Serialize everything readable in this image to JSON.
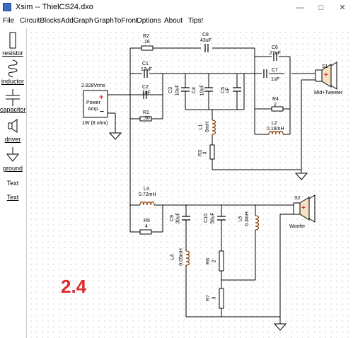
{
  "window": {
    "title": "Xsim -- ThielCS24.dxo"
  },
  "menu": [
    "File",
    "CircuitBlocks",
    "AddGraph",
    "GraphToFront",
    "Options",
    "About",
    "Tips!"
  ],
  "sidebar": {
    "resistor": "resistor",
    "inductor": "inductor",
    "capacitor": "capacitor",
    "driver": "driver",
    "ground": "ground",
    "text1": "Text",
    "text2": "Text"
  },
  "source": {
    "voltage": "2.828Vrms",
    "line1": "Power",
    "line2": "Amp.",
    "note": "1W (8 ohm)"
  },
  "parts": {
    "R2": {
      "name": "R2",
      "value": ".16"
    },
    "C8": {
      "name": "C8",
      "value": "43uF"
    },
    "C1": {
      "name": "C1",
      "value": "13uF"
    },
    "C2": {
      "name": "C2",
      "value": "1uF"
    },
    "R1": {
      "name": "R1",
      "value": ".30"
    },
    "C3": {
      "name": "C3",
      "value": "10uF"
    },
    "C4": {
      "name": "C4",
      "value": "10uF"
    },
    "C5": {
      "name": "C5",
      "value": "uF"
    },
    "C6": {
      "name": "C6",
      "value": "27uF"
    },
    "C7": {
      "name": "C7",
      "value": "1uF"
    },
    "R4": {
      "name": "R4",
      "value": "2"
    },
    "L2": {
      "name": "L2",
      "value": "0.16mH"
    },
    "L1": {
      "name": "L1",
      "value": "6mH"
    },
    "R3": {
      "name": "R3",
      "value": "3"
    },
    "L3": {
      "name": "L3",
      "value": "0.72mH"
    },
    "R5": {
      "name": "R5",
      "value": "4"
    },
    "C9": {
      "name": "C9",
      "value": "30uF"
    },
    "C10": {
      "name": "C10",
      "value": "56uF"
    },
    "L5": {
      "name": "L5",
      "value": "0.3mH"
    },
    "L4": {
      "name": "L4",
      "value": "0.05mH"
    },
    "R6": {
      "name": "R6",
      "value": "2"
    },
    "R7": {
      "name": "R7",
      "value": "3"
    }
  },
  "speakers": {
    "S1": {
      "name": "S1",
      "label": "Mid+Tweeter"
    },
    "S2": {
      "name": "S2",
      "label": "Woofer"
    }
  },
  "annotation": "2.4",
  "colors": {
    "wire": "#000000",
    "inductor": "#8a3a00",
    "label_red": "#e0272b",
    "polarity": "#e0272b"
  }
}
